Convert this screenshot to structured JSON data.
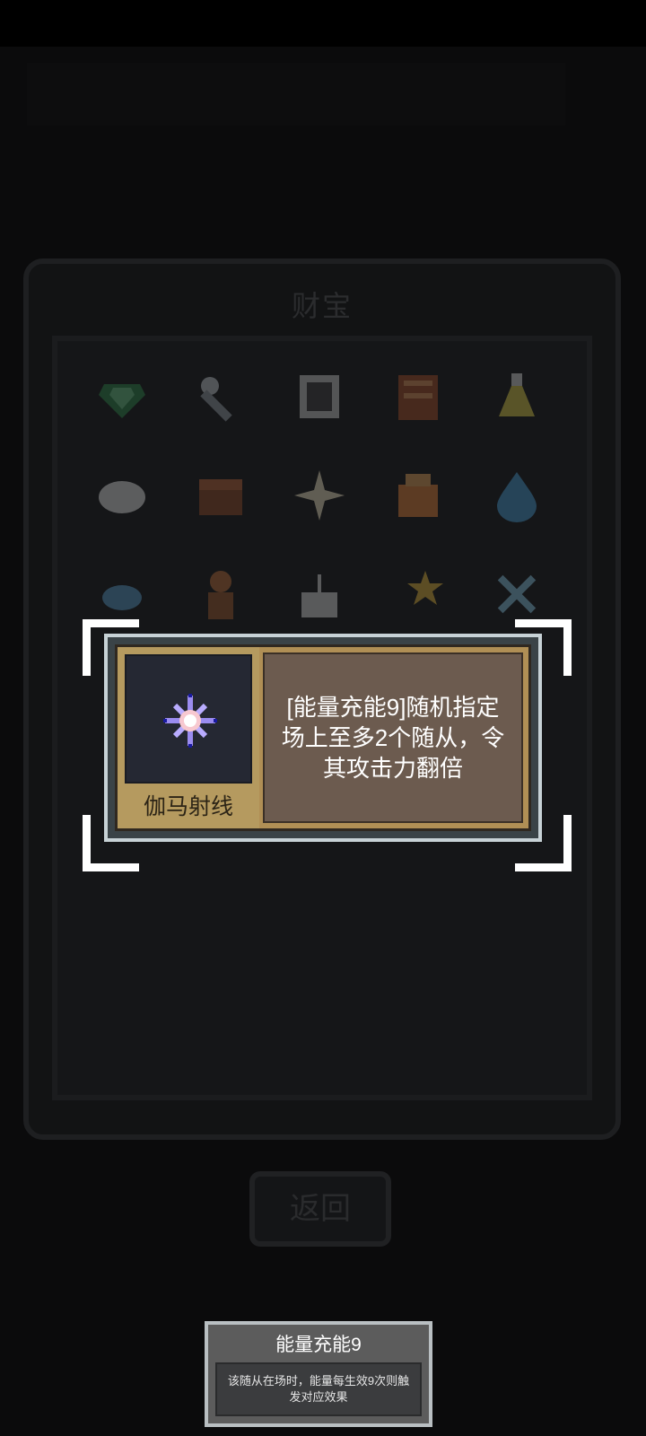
{
  "panel": {
    "title": "财宝"
  },
  "return_button": {
    "label": "返回"
  },
  "highlight_card": {
    "name": "伽马射线",
    "description": "[能量充能9]随机指定场上至多2个随从，令其攻击力翻倍",
    "icon": "star-sparkle-icon"
  },
  "tooltip": {
    "title": "能量充能9",
    "body": "该随从在场时，能量每生效9次则触发对应效果"
  },
  "grid_items": [
    "emerald-gem-icon",
    "wrench-icon",
    "scroll-icon",
    "book-icon",
    "potion-icon",
    "egg-icon",
    "treasure-chest-icon",
    "sparkle-icon",
    "pouch-icon",
    "water-drop-icon",
    "crab-icon",
    "statue-icon",
    "cake-icon",
    "star-wand-icon",
    "crossed-swords-icon"
  ],
  "colors": {
    "card_frame": "#b08f55",
    "card_text_bg": "#6c5b4f",
    "icon_bg": "#252833",
    "bracket": "#ffffff"
  }
}
